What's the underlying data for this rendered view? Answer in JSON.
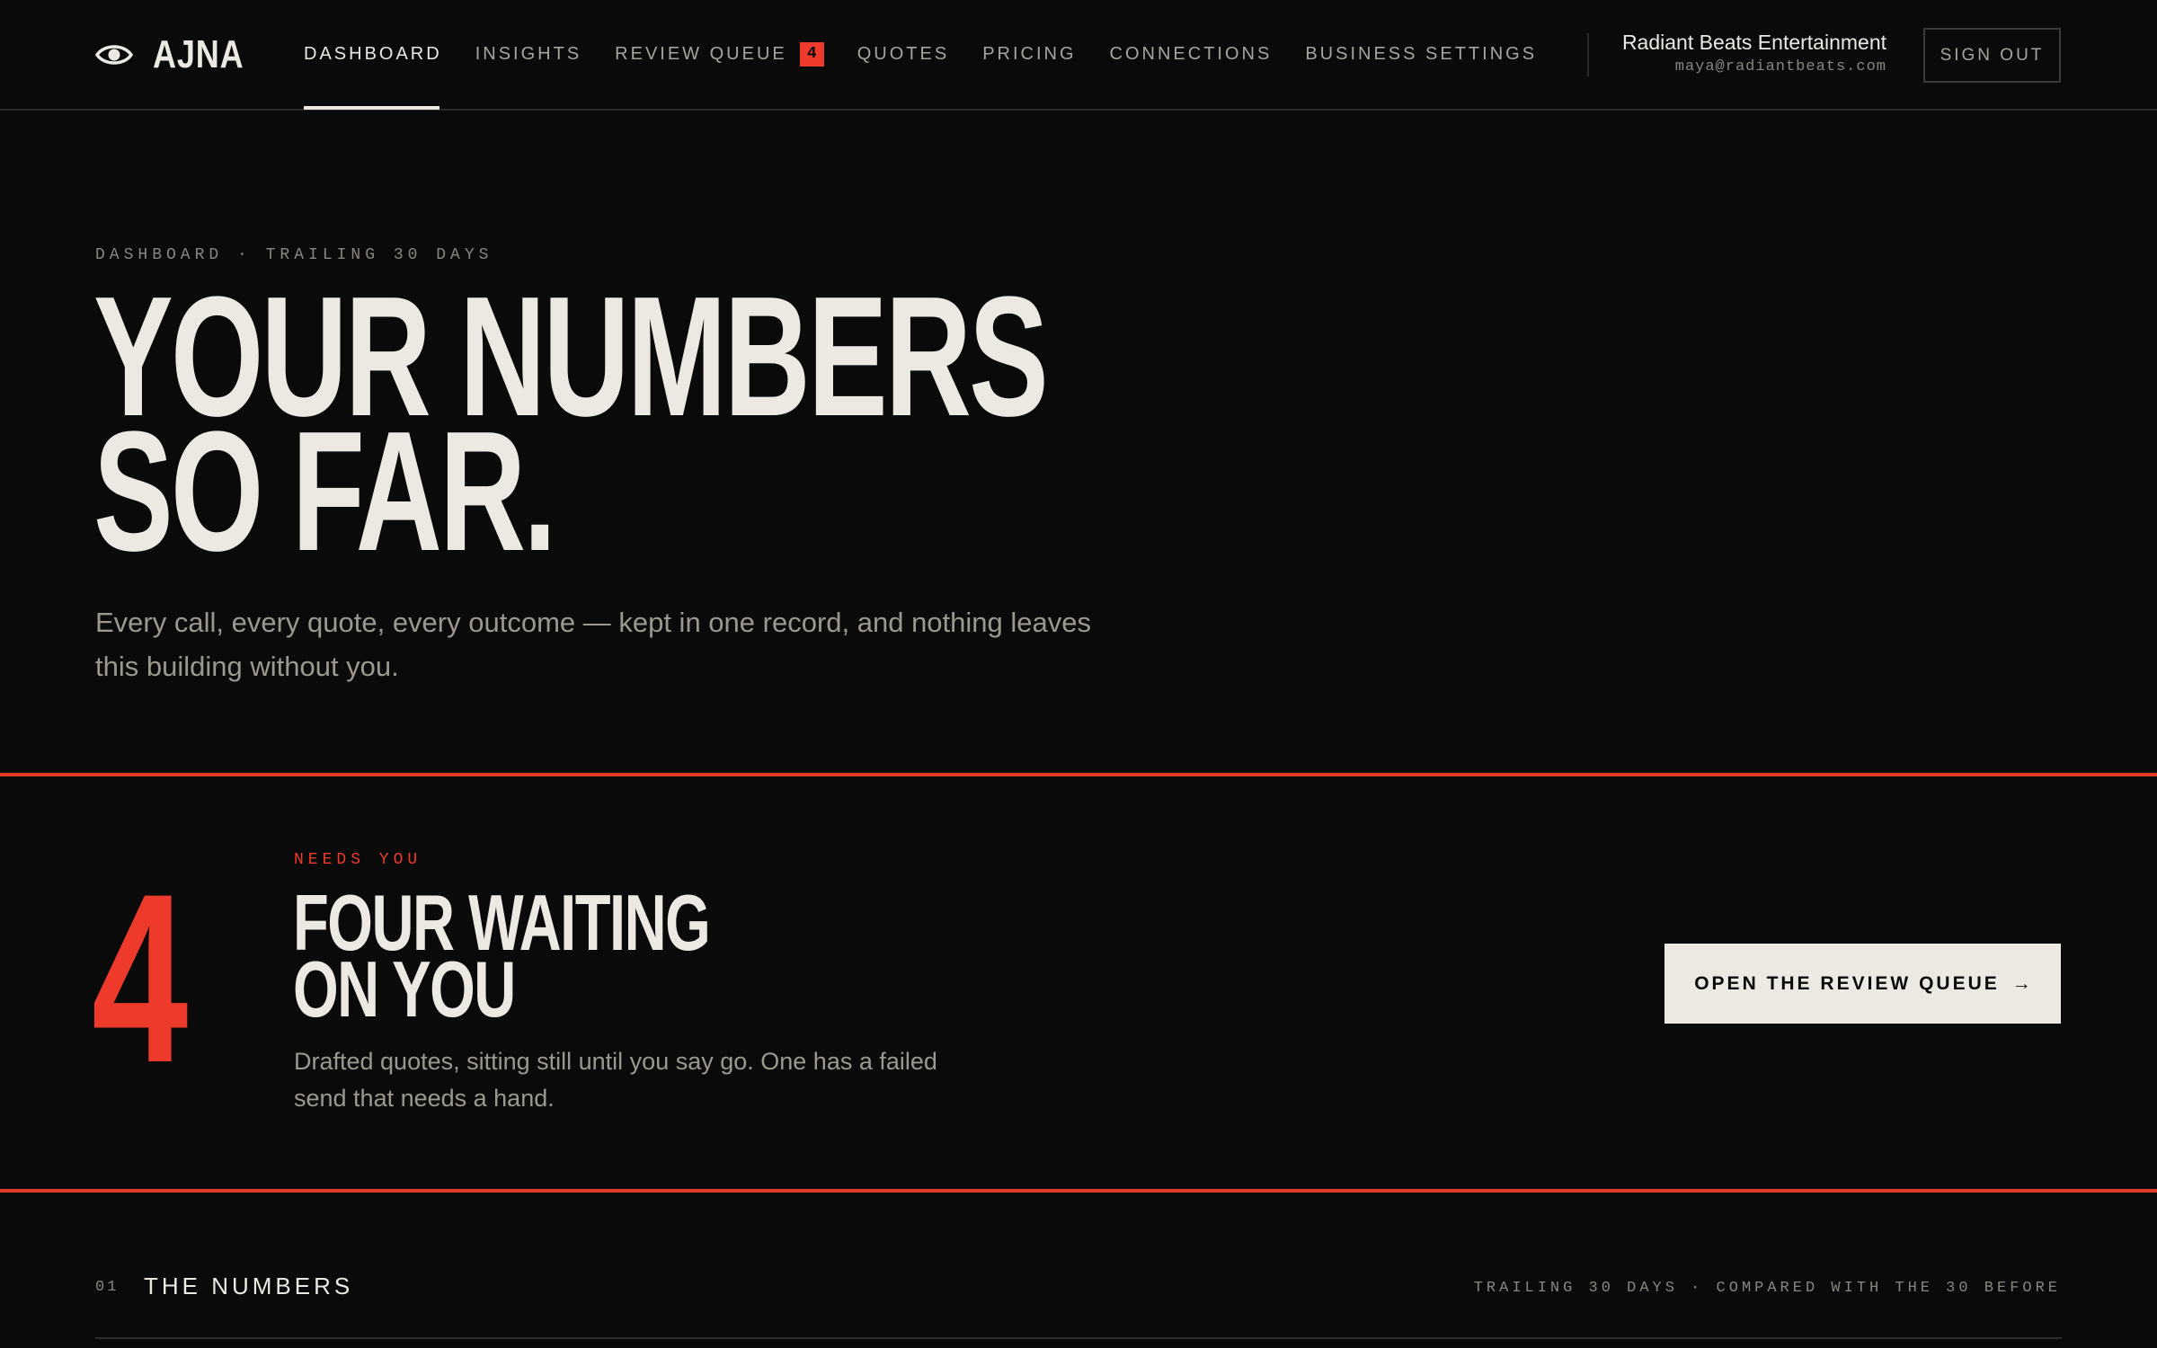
{
  "brand": {
    "name": "AJNA",
    "icon": "eye-icon"
  },
  "nav": {
    "items": [
      {
        "label": "DASHBOARD",
        "active": true
      },
      {
        "label": "INSIGHTS",
        "active": false
      },
      {
        "label": "REVIEW QUEUE",
        "active": false,
        "badge": "4"
      },
      {
        "label": "QUOTES",
        "active": false
      },
      {
        "label": "PRICING",
        "active": false
      },
      {
        "label": "CONNECTIONS",
        "active": false
      },
      {
        "label": "BUSINESS SETTINGS",
        "active": false
      }
    ]
  },
  "account": {
    "name": "Radiant Beats Entertainment",
    "email": "maya@radiantbeats.com",
    "sign_out_label": "SIGN OUT"
  },
  "hero": {
    "eyebrow": "DASHBOARD · TRAILING 30 DAYS",
    "title_line1": "YOUR NUMBERS",
    "title_line2": "SO FAR.",
    "subtitle": "Every call, every quote, every outcome — kept in one record, and nothing leaves this building without you."
  },
  "alert": {
    "count": "4",
    "label": "NEEDS YOU",
    "title_line1": "FOUR WAITING",
    "title_line2": "ON YOU",
    "description": "Drafted quotes, sitting still until you say go. One has a failed send that needs a hand.",
    "cta_label": "OPEN THE REVIEW QUEUE",
    "cta_arrow": "→"
  },
  "numbers_section": {
    "index": "01",
    "title": "THE NUMBERS",
    "meta": "TRAILING 30 DAYS · COMPARED WITH THE 30 BEFORE"
  },
  "colors": {
    "background": "#0a0a0a",
    "text": "#ece9e2",
    "muted": "#9c988f",
    "accent": "#ee3a2a"
  }
}
